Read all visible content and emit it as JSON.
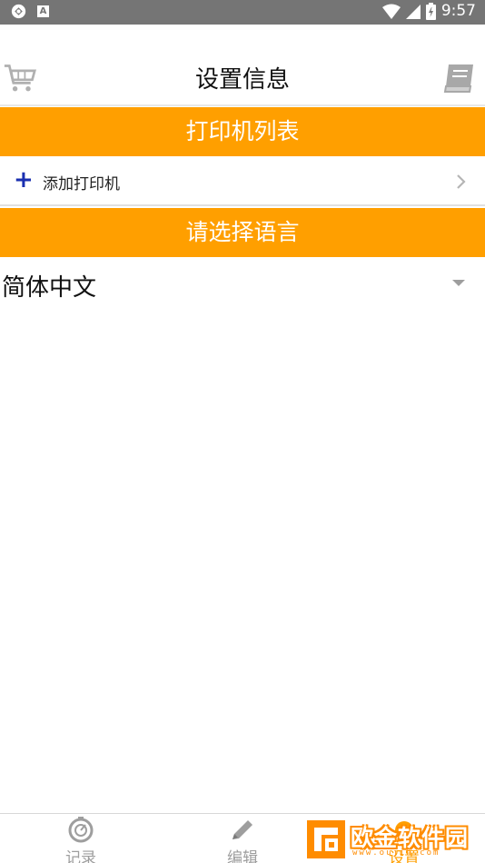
{
  "status_bar": {
    "time": "9:57",
    "left_icons": [
      "sync-icon",
      "a-notification-icon"
    ],
    "notification_letter": "A",
    "right_icons": [
      "wifi-icon",
      "signal-icon",
      "battery-icon"
    ]
  },
  "header": {
    "title": "设置信息",
    "left_icon": "cart-icon",
    "right_icon": "book-icon"
  },
  "printer_section": {
    "title": "打印机列表",
    "add_label": "添加打印机"
  },
  "language_section": {
    "title": "请选择语言",
    "selected": "简体中文"
  },
  "bottom_nav": {
    "items": [
      {
        "label": "记录",
        "icon": "record-icon"
      },
      {
        "label": "编辑",
        "icon": "pencil-icon"
      },
      {
        "label": "设置",
        "icon": "gear-icon"
      }
    ]
  },
  "watermark": {
    "text": "欧金软件园",
    "url": "www.oujin.com"
  },
  "colors": {
    "accent": "#ff9f00",
    "status_bar": "#757575",
    "plus": "#1a2fb0",
    "inactive_nav": "#9e9e9e"
  }
}
